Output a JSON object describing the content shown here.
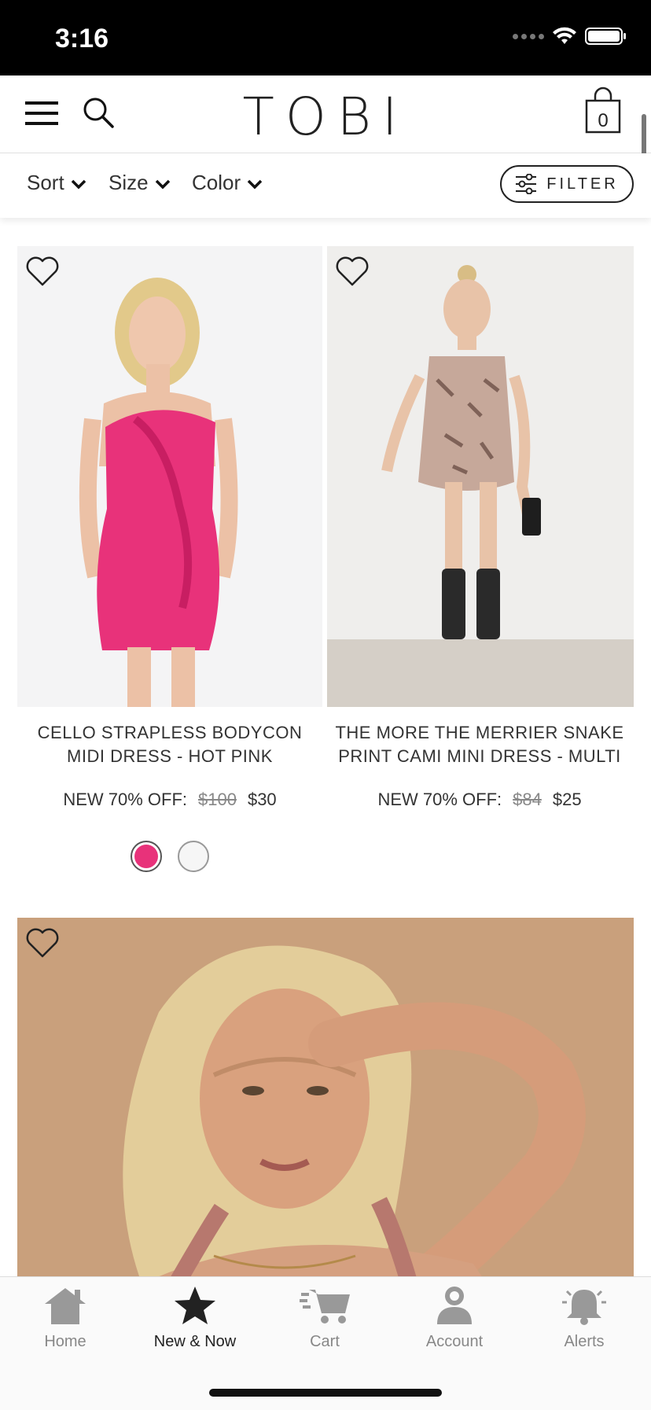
{
  "status_bar": {
    "time": "3:16"
  },
  "header": {
    "logo": "TOBI",
    "cart_count": "0"
  },
  "filters": {
    "sort_label": "Sort",
    "size_label": "Size",
    "color_label": "Color",
    "filter_label": "FILTER"
  },
  "products": [
    {
      "title_line1": "CELLO STRAPLESS BODYCON",
      "title_line2": "MIDI DRESS - HOT PINK",
      "price_prefix": "NEW 70% OFF:",
      "old_price": "$100",
      "new_price": "$30",
      "swatches": [
        "#e8327a",
        "#f6f6f6"
      ]
    },
    {
      "title_line1": "THE MORE THE MERRIER SNAKE",
      "title_line2": "PRINT CAMI MINI DRESS - MULTI",
      "price_prefix": "NEW 70% OFF:",
      "old_price": "$84",
      "new_price": "$25"
    }
  ],
  "tabbar": {
    "tabs": [
      {
        "label": "Home",
        "icon": "home-icon"
      },
      {
        "label": "New & Now",
        "icon": "star-icon",
        "active": true
      },
      {
        "label": "Cart",
        "icon": "cart-icon"
      },
      {
        "label": "Account",
        "icon": "account-icon"
      },
      {
        "label": "Alerts",
        "icon": "bell-icon"
      }
    ]
  },
  "colors": {
    "accent_pink": "#e8327a",
    "text_dark": "#222222",
    "tab_inactive": "#888888"
  }
}
